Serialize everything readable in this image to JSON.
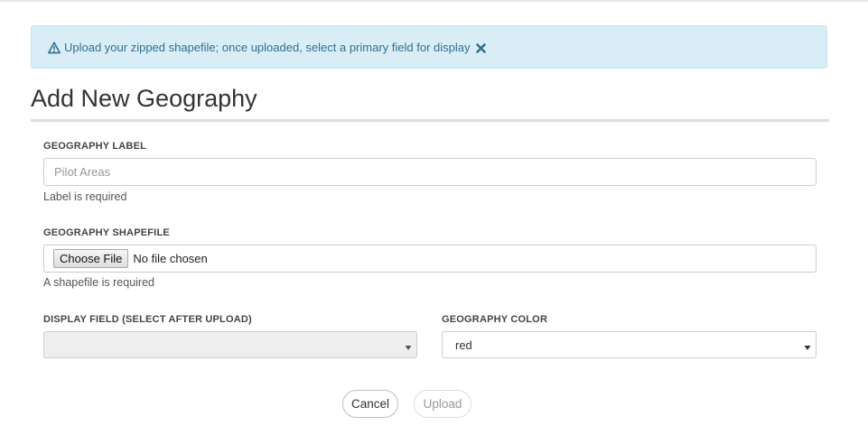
{
  "alert": {
    "message": "Upload your zipped shapefile; once uploaded, select a primary field for display",
    "icon": "warning-triangle-icon",
    "dismiss_icon": "close-x-icon",
    "colors": {
      "background": "#d9edf7",
      "border": "#bce8f1",
      "text": "#31708f"
    }
  },
  "page": {
    "title": "Add New Geography"
  },
  "form": {
    "label_field": {
      "label": "GEOGRAPHY LABEL",
      "placeholder": "Pilot Areas",
      "value": "",
      "help": "Label is required"
    },
    "shapefile_field": {
      "label": "GEOGRAPHY SHAPEFILE",
      "button_label": "Choose File",
      "status": "No file chosen",
      "help": "A shapefile is required"
    },
    "display_field": {
      "label": "DISPLAY FIELD (SELECT AFTER UPLOAD)",
      "selected": "",
      "disabled": true
    },
    "color_field": {
      "label": "GEOGRAPHY COLOR",
      "selected": "red"
    }
  },
  "actions": {
    "cancel_label": "Cancel",
    "upload_label": "Upload",
    "upload_disabled": true
  }
}
